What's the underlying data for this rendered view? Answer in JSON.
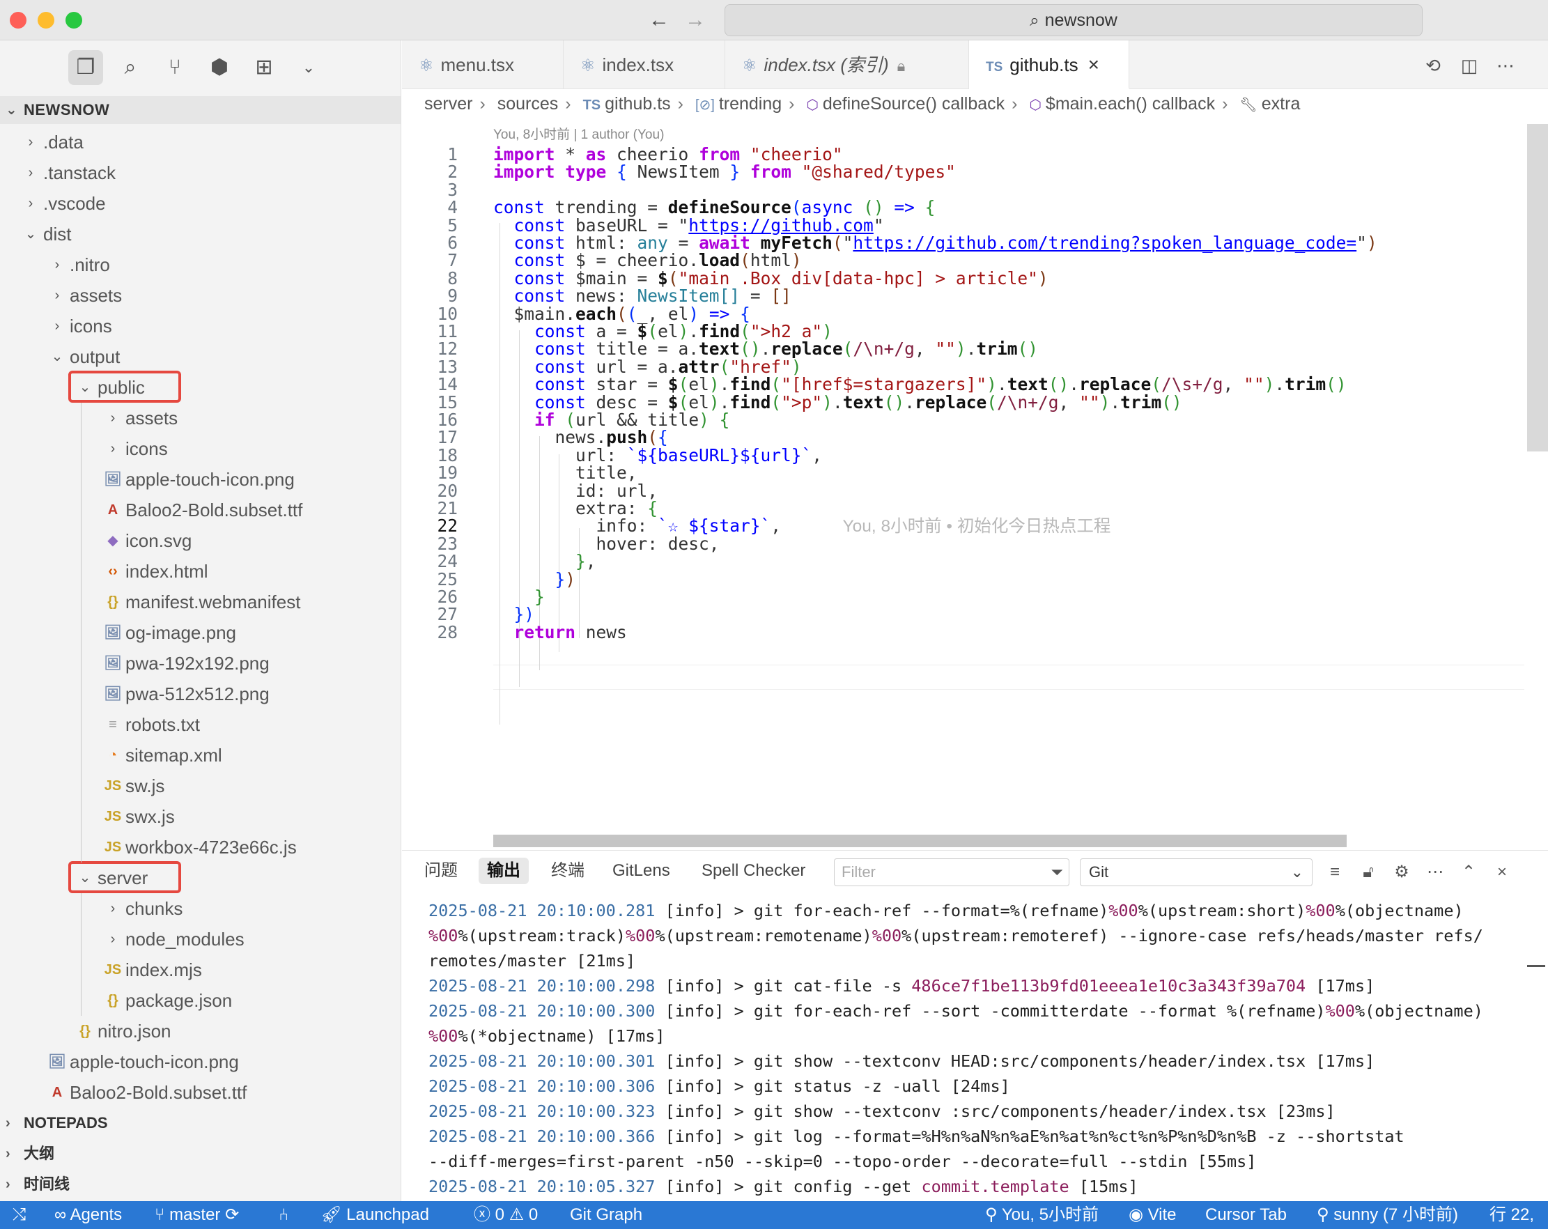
{
  "window": {
    "search_text": "newsnow"
  },
  "sidebar": {
    "explorer_title": "NEWSNOW",
    "tree": [
      {
        "label": ".data",
        "depth": 0,
        "kind": "folder",
        "expanded": false
      },
      {
        "label": ".tanstack",
        "depth": 0,
        "kind": "folder",
        "expanded": false
      },
      {
        "label": ".vscode",
        "depth": 0,
        "kind": "folder",
        "expanded": false
      },
      {
        "label": "dist",
        "depth": 0,
        "kind": "folder",
        "expanded": true
      },
      {
        "label": ".nitro",
        "depth": 1,
        "kind": "folder",
        "expanded": false
      },
      {
        "label": "assets",
        "depth": 1,
        "kind": "folder",
        "expanded": false
      },
      {
        "label": "icons",
        "depth": 1,
        "kind": "folder",
        "expanded": false
      },
      {
        "label": "output",
        "depth": 1,
        "kind": "folder",
        "expanded": true
      },
      {
        "label": "public",
        "depth": 2,
        "kind": "folder",
        "expanded": true,
        "highlight": true
      },
      {
        "label": "assets",
        "depth": 3,
        "kind": "folder",
        "expanded": false
      },
      {
        "label": "icons",
        "depth": 3,
        "kind": "folder",
        "expanded": false
      },
      {
        "label": "apple-touch-icon.png",
        "depth": 3,
        "kind": "image"
      },
      {
        "label": "Baloo2-Bold.subset.ttf",
        "depth": 3,
        "kind": "font"
      },
      {
        "label": "icon.svg",
        "depth": 3,
        "kind": "svg"
      },
      {
        "label": "index.html",
        "depth": 3,
        "kind": "html"
      },
      {
        "label": "manifest.webmanifest",
        "depth": 3,
        "kind": "json"
      },
      {
        "label": "og-image.png",
        "depth": 3,
        "kind": "image"
      },
      {
        "label": "pwa-192x192.png",
        "depth": 3,
        "kind": "image"
      },
      {
        "label": "pwa-512x512.png",
        "depth": 3,
        "kind": "image"
      },
      {
        "label": "robots.txt",
        "depth": 3,
        "kind": "text"
      },
      {
        "label": "sitemap.xml",
        "depth": 3,
        "kind": "rss"
      },
      {
        "label": "sw.js",
        "depth": 3,
        "kind": "js"
      },
      {
        "label": "swx.js",
        "depth": 3,
        "kind": "js"
      },
      {
        "label": "workbox-4723e66c.js",
        "depth": 3,
        "kind": "js"
      },
      {
        "label": "server",
        "depth": 2,
        "kind": "folder",
        "expanded": true,
        "highlight": true
      },
      {
        "label": "chunks",
        "depth": 3,
        "kind": "folder",
        "expanded": false
      },
      {
        "label": "node_modules",
        "depth": 3,
        "kind": "folder",
        "expanded": false
      },
      {
        "label": "index.mjs",
        "depth": 3,
        "kind": "js"
      },
      {
        "label": "package.json",
        "depth": 3,
        "kind": "json"
      },
      {
        "label": "nitro.json",
        "depth": 2,
        "kind": "json"
      },
      {
        "label": "apple-touch-icon.png",
        "depth": 1,
        "kind": "image"
      },
      {
        "label": "Baloo2-Bold.subset.ttf",
        "depth": 1,
        "kind": "font"
      }
    ],
    "sections": [
      "NOTEPADS",
      "大纲",
      "时间线"
    ]
  },
  "editor": {
    "tabs": [
      {
        "label": "menu.tsx",
        "icon": "react-icon"
      },
      {
        "label": "index.tsx",
        "icon": "react-icon"
      },
      {
        "label": "index.tsx (索引)",
        "icon": "react-icon",
        "italic": true,
        "locked": true
      },
      {
        "label": "github.ts",
        "icon": "TS",
        "active": true
      }
    ],
    "breadcrumb": [
      "server",
      "sources",
      "github.ts",
      "trending",
      "defineSource() callback",
      "$main.each() callback",
      "extra"
    ],
    "blame_header": "You, 8小时前 | 1 author (You)",
    "current_line": 22,
    "inline_blame": "You, 8小时前 • 初始化今日热点工程",
    "lines": [
      "1",
      "2",
      "3",
      "4",
      "5",
      "6",
      "7",
      "8",
      "9",
      "10",
      "11",
      "12",
      "13",
      "14",
      "15",
      "16",
      "17",
      "18",
      "19",
      "20",
      "21",
      "22",
      "23",
      "24",
      "25",
      "26",
      "27",
      "28"
    ],
    "code": {
      "import_kw": "import",
      "as_kw": "as",
      "from_kw": "from",
      "type_kw": "type",
      "cheerio_mod": "\"cheerio\"",
      "shared_mod": "\"@shared/types\"",
      "base_url": "https://github.com",
      "trending_url": "https://github.com/trending?spoken_language_code=",
      "selector_main": "\"main .Box div[data-hpc] > article\"",
      "selector_h2": "\">h2 a\"",
      "selector_star": "\"[href$=stargazers]\"",
      "selector_p": "\">p\"",
      "href_attr": "\"href\""
    }
  },
  "panel": {
    "tabs": [
      "问题",
      "输出",
      "终端",
      "GitLens",
      "Spell Checker"
    ],
    "active_tab": "输出",
    "filter_placeholder": "Filter",
    "channel": "Git",
    "log": [
      {
        "ts": "2025-08-21 20:10:00.281",
        "text": " [info] > git for-each-ref --format=%(refname)%00%(upstream:short)%00%(objectname)"
      },
      {
        "ts": "",
        "text": "%00%(upstream:track)%00%(upstream:remotename)%00%(upstream:remoteref) --ignore-case refs/heads/master refs/"
      },
      {
        "ts": "",
        "text": "remotes/master [21ms]"
      },
      {
        "ts": "2025-08-21 20:10:00.298",
        "text": " [info] > git cat-file -s ",
        "hash": "486ce7f1be113b9fd01eeea1e10c3a343f39a704",
        "tail": " [17ms]"
      },
      {
        "ts": "2025-08-21 20:10:00.300",
        "text": " [info] > git for-each-ref --sort -committerdate --format %(refname)%00%(objectname)"
      },
      {
        "ts": "",
        "text": "%00%(*objectname) [17ms]"
      },
      {
        "ts": "2025-08-21 20:10:00.301",
        "text": " [info] > git show --textconv HEAD:src/components/header/index.tsx [17ms]"
      },
      {
        "ts": "2025-08-21 20:10:00.306",
        "text": " [info] > git status -z -uall [24ms]"
      },
      {
        "ts": "2025-08-21 20:10:00.323",
        "text": " [info] > git show --textconv :src/components/header/index.tsx [23ms]"
      },
      {
        "ts": "2025-08-21 20:10:00.366",
        "text": " [info] > git log --format=%H%n%aN%n%aE%n%at%n%ct%n%P%n%D%n%B -z --shortstat"
      },
      {
        "ts": "",
        "text": "--diff-merges=first-parent -n50 --skip=0 --topo-order --decorate=full --stdin [55ms]"
      },
      {
        "ts": "2025-08-21 20:10:05.327",
        "text": " [info] > git config --get ",
        "hash": "commit.template",
        "tail": " [15ms]"
      }
    ]
  },
  "statusbar": {
    "agents": "Agents",
    "branch": "master",
    "launchpad": "Launchpad",
    "errors": "0",
    "warnings": "0",
    "git_graph": "Git Graph",
    "blame": "You, 5小时前",
    "vite": "Vite",
    "cursor_tab": "Cursor Tab",
    "author": "sunny (7 小时前)",
    "position": "行 22,"
  },
  "colors": {
    "accent": "#2a78d4",
    "highlight_box": "#e5483f"
  }
}
